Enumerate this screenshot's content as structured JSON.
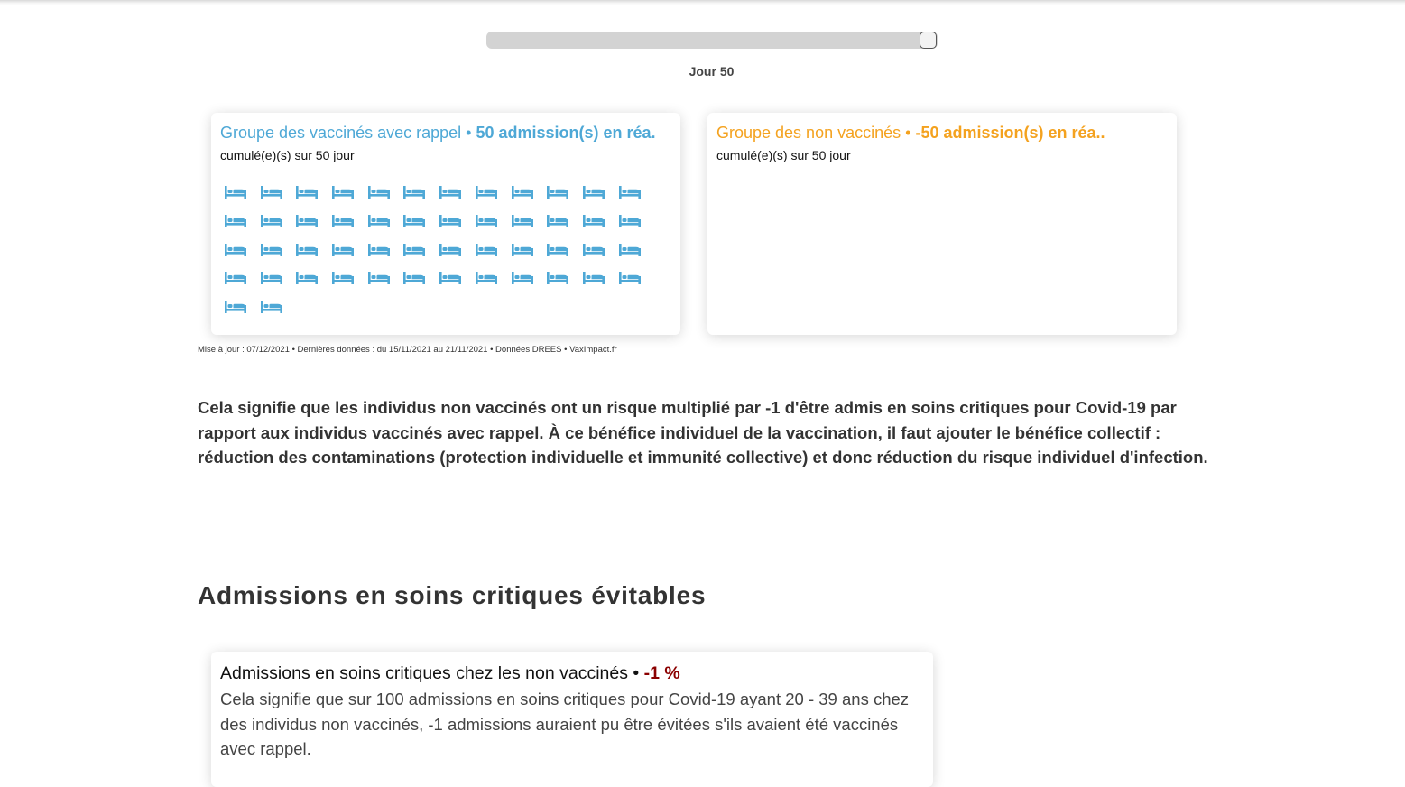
{
  "slider": {
    "day_label": "Jour 50",
    "value_fraction": 0.98
  },
  "vaccinated_card": {
    "group_label": "Groupe des vaccinés avec rappel",
    "separator": " • ",
    "count_label": "50 admission(s) en réa.",
    "subtitle": "cumulé(e)(s) sur 50 jour",
    "bed_count": 50,
    "color": "#4ea8d6"
  },
  "nonvaccinated_card": {
    "group_label": "Groupe des non vaccinés",
    "separator": " • ",
    "count_label": "-50 admission(s) en réa..",
    "subtitle": "cumulé(e)(s) sur 50 jour",
    "bed_count": 0,
    "color": "#f4a21f"
  },
  "footnote": "Mise à jour : 07/12/2021 • Dernières données : du 15/11/2021 au 21/11/2021 • Données DREES • VaxImpact.fr",
  "explanation": "Cela signifie que les individus non vaccinés ont un risque multiplié par -1 d'être admis en soins critiques pour Covid-19 par rapport aux individus vaccinés avec rappel. À ce bénéfice individuel de la vaccination, il faut ajouter le bénéfice collectif : réduction des contaminations (protection individuelle et immunité collective) et donc réduction du risque individuel d'infection.",
  "section_title": "Admissions en soins critiques évitables",
  "avoidable_card": {
    "title": "Admissions en soins critiques chez les non vaccinés",
    "separator": " • ",
    "percent": "-1 %",
    "text": "Cela signifie que sur 100 admissions en soins critiques pour Covid-19 ayant 20 - 39 ans chez des individus non vaccinés, -1 admissions auraient pu être évitées s'ils avaient été vaccinés avec rappel."
  },
  "icons": {
    "bed": "bed-icon"
  }
}
